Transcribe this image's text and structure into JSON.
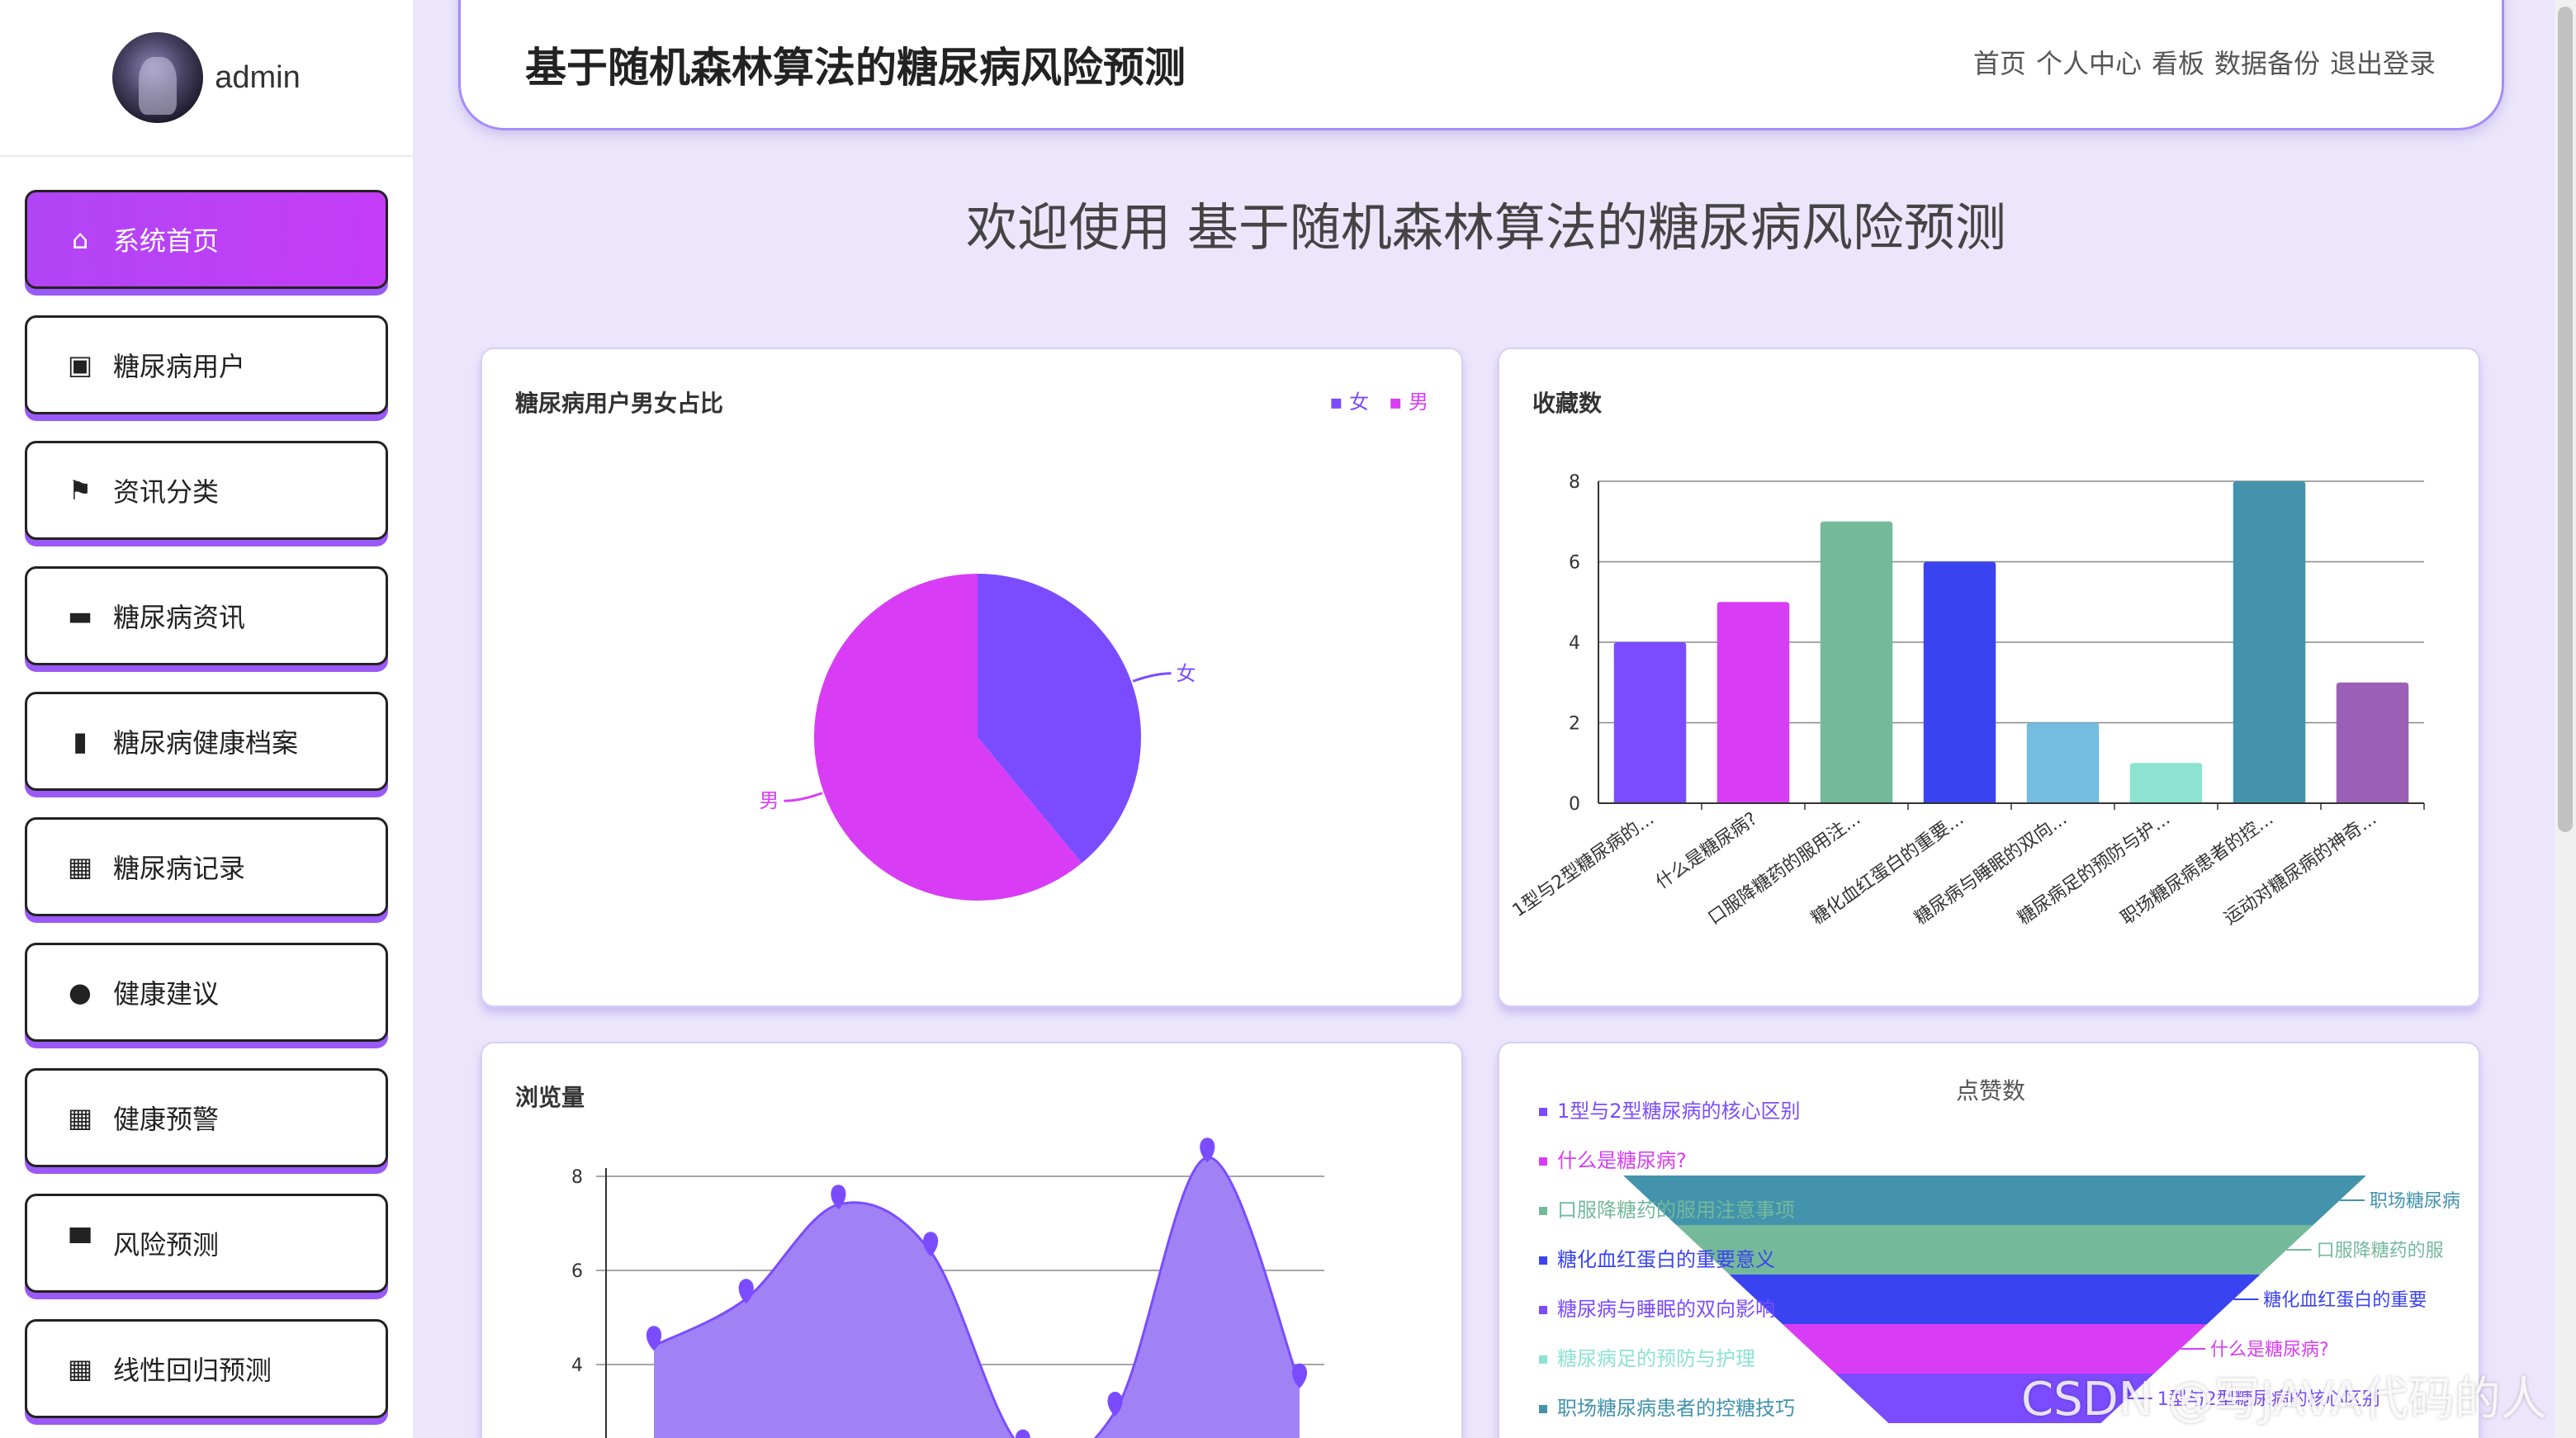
{
  "sidebar": {
    "username": "admin",
    "items": [
      {
        "label": "系统首页",
        "icon": "home-icon",
        "glyph": "⌂",
        "active": true
      },
      {
        "label": "糖尿病用户",
        "icon": "clipboard-icon",
        "glyph": "▣",
        "active": false
      },
      {
        "label": "资讯分类",
        "icon": "flag-icon",
        "glyph": "⚑",
        "active": false
      },
      {
        "label": "糖尿病资讯",
        "icon": "ticket-icon",
        "glyph": "▬",
        "active": false
      },
      {
        "label": "糖尿病健康档案",
        "icon": "bar-chart-icon",
        "glyph": "▮",
        "active": false
      },
      {
        "label": "糖尿病记录",
        "icon": "grid-icon",
        "glyph": "▦",
        "active": false
      },
      {
        "label": "健康建议",
        "icon": "bulb-icon",
        "glyph": "●",
        "active": false
      },
      {
        "label": "健康预警",
        "icon": "grid-icon",
        "glyph": "▦",
        "active": false
      },
      {
        "label": "风险预测",
        "icon": "robot-icon",
        "glyph": "▀",
        "active": false
      },
      {
        "label": "线性回归预测",
        "icon": "grid-icon",
        "glyph": "▦",
        "active": false
      }
    ]
  },
  "header": {
    "title": "基于随机森林算法的糖尿病风险预测",
    "nav": [
      "首页",
      "个人中心",
      "看板",
      "数据备份",
      "退出登录"
    ]
  },
  "welcome": "欢迎使用 基于随机森林算法的糖尿病风险预测",
  "colors": {
    "accent": "#b145f5",
    "purple": "#7b4cff",
    "magenta": "#d83df5"
  },
  "watermark": "CSDN @写JAVA代码的人",
  "chart_data": [
    {
      "type": "pie",
      "title": "糖尿病用户男女占比",
      "legend": [
        "女",
        "男"
      ],
      "slices": [
        {
          "name": "女",
          "value": 39,
          "color": "#7b4cff"
        },
        {
          "name": "男",
          "value": 61,
          "color": "#d83df5"
        }
      ]
    },
    {
      "type": "bar",
      "title": "收藏数",
      "categories": [
        "1型与2型糖尿病的...",
        "什么是糖尿病?",
        "口服降糖药的服用注...",
        "糖化血红蛋白的重要...",
        "糖尿病与睡眠的双向...",
        "糖尿病足的预防与护...",
        "职场糖尿病患者的控...",
        "运动对糖尿病的神奇..."
      ],
      "tick_labels": [
        "1型与2型糖尿病的...",
        "什么是糖尿病?",
        "口服降糖药的服用注...",
        "糖化血红蛋白的重要...",
        "糖尿病与睡眠的双向...",
        "糖尿病足的预防与护...",
        "职场糖尿病患者的控...",
        "运动对糖尿病的神奇..."
      ],
      "values": [
        4,
        5,
        7,
        6,
        2,
        1,
        8,
        3
      ],
      "colors": [
        "#7b4cff",
        "#d83df5",
        "#74b99a",
        "#3a43f0",
        "#74bde0",
        "#8de3d2",
        "#4393ad",
        "#9b5fb5"
      ],
      "ylim": [
        0,
        8
      ],
      "yticks": [
        0,
        2,
        4,
        6,
        8
      ]
    },
    {
      "type": "area",
      "title": "浏览量",
      "values": [
        4.4,
        5.4,
        7.4,
        6.4,
        2.2,
        3.0,
        8.4,
        3.6
      ],
      "ylim": [
        2,
        8
      ],
      "yticks": [
        4,
        6,
        8
      ]
    },
    {
      "type": "funnel",
      "title": "点赞数",
      "legend": [
        "1型与2型糖尿病的核心区别",
        "什么是糖尿病?",
        "口服降糖药的服用注意事项",
        "糖化血红蛋白的重要意义",
        "糖尿病与睡眠的双向影响",
        "糖尿病足的预防与护理",
        "职场糖尿病患者的控糖技巧"
      ],
      "legend_colors": [
        "#7b4cff",
        "#d83df5",
        "#74b99a",
        "#3a43f0",
        "#7b4cff",
        "#8de3d2",
        "#4393ad"
      ],
      "layers": [
        {
          "label": "职场糖尿病",
          "color": "#4393ad"
        },
        {
          "label": "口服降糖药的服",
          "color": "#74b99a"
        },
        {
          "label": "糖化血红蛋白的重要",
          "color": "#3a43f0"
        },
        {
          "label": "什么是糖尿病?",
          "color": "#d83df5"
        },
        {
          "label": "1型与2型糖尿病的核心区别",
          "color": "#7b4cff"
        }
      ]
    }
  ]
}
